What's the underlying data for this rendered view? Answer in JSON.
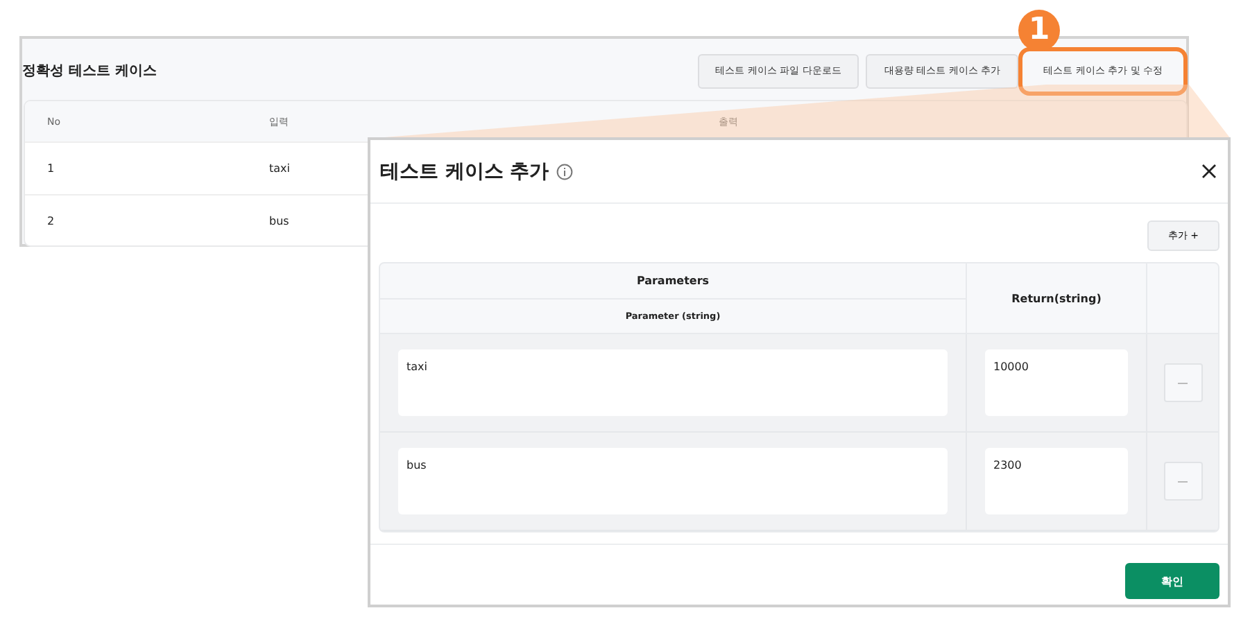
{
  "panel": {
    "title": "정확성 테스트 케이스",
    "buttons": [
      {
        "label": "테스트 케이스 파일 다운로드",
        "highlighted": false
      },
      {
        "label": "대용량 테스트 케이스 추가",
        "highlighted": false
      },
      {
        "label": "테스트 케이스 추가 및 수정",
        "highlighted": true
      }
    ],
    "table": {
      "columns": [
        "No",
        "입력",
        "출력"
      ],
      "rows": [
        [
          "1",
          "taxi"
        ],
        [
          "2",
          "bus"
        ]
      ]
    }
  },
  "callout": {
    "number": "1"
  },
  "modal": {
    "title": "테스트 케이스 추가",
    "add_button": "추가 +",
    "group_header": "Parameters",
    "param_header": "Parameter (string)",
    "return_header": "Return(string)",
    "rows": [
      {
        "parameter": "taxi",
        "return": "10000"
      },
      {
        "parameter": "bus",
        "return": "2300"
      }
    ],
    "confirm_button": "확인"
  }
}
